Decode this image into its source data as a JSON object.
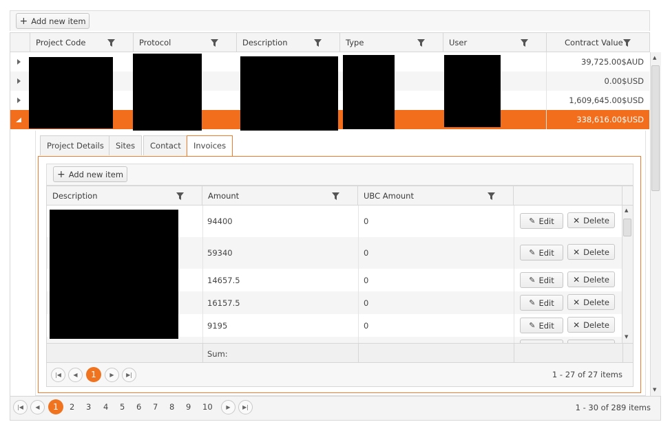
{
  "toolbar": {
    "add_label": "Add new item"
  },
  "grid": {
    "columns": [
      "Project Code",
      "Protocol",
      "Description",
      "Type",
      "User",
      "Contract Value"
    ],
    "rows": [
      {
        "contract_value": "39,725.00$AUD",
        "expanded": false
      },
      {
        "contract_value": "0.00$USD",
        "expanded": false
      },
      {
        "contract_value": "1,609,645.00$USD",
        "expanded": false
      },
      {
        "contract_value": "338,616.00$USD",
        "expanded": true,
        "selected": true
      }
    ],
    "pager": {
      "pages": [
        "1",
        "2",
        "3",
        "4",
        "5",
        "6",
        "7",
        "8",
        "9",
        "10"
      ],
      "current": "1",
      "info": "1 - 30 of 289 items"
    }
  },
  "detail": {
    "tabs": [
      "Project Details",
      "Sites",
      "Contact",
      "Invoices"
    ],
    "active_tab": "Invoices",
    "add_label": "Add new item",
    "columns": [
      "Description",
      "Amount",
      "UBC Amount"
    ],
    "rows": [
      {
        "amount": "94400",
        "ubc_amount": "0"
      },
      {
        "amount": "59340",
        "ubc_amount": "0"
      },
      {
        "amount": "14657.5",
        "ubc_amount": "0"
      },
      {
        "amount": "16157.5",
        "ubc_amount": "0"
      },
      {
        "amount": "9195",
        "ubc_amount": "0"
      }
    ],
    "edit_label": "Edit",
    "delete_label": "Delete",
    "footer_sum_label": "Sum:",
    "pager": {
      "current": "1",
      "info": "1 - 27 of 27 items"
    }
  },
  "colors": {
    "accent": "#f0731f",
    "selected_row": "#f26e1c",
    "header_bg": "#f4f4f4"
  }
}
